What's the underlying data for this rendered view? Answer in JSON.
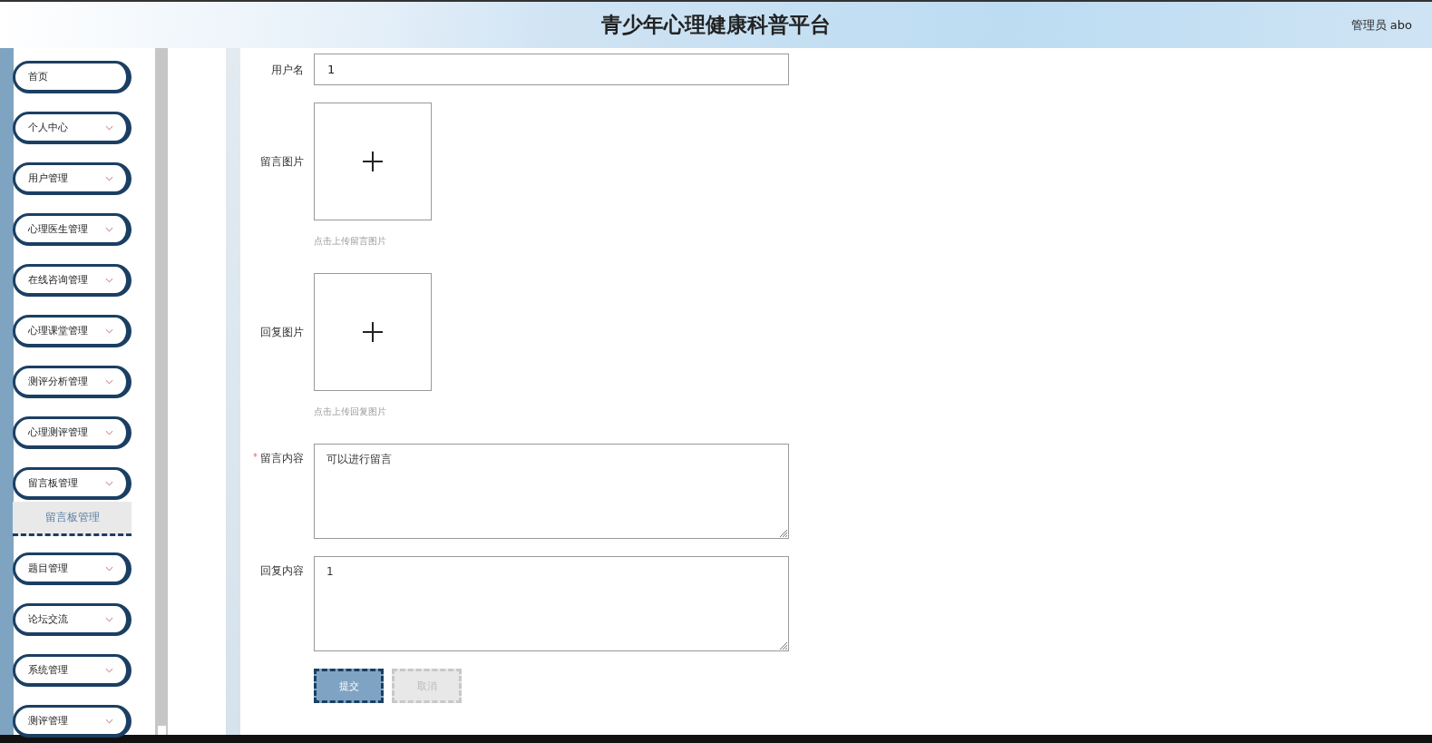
{
  "header": {
    "title": "青少年心理健康科普平台",
    "user": "管理员 abo"
  },
  "sidebar": {
    "items": [
      {
        "label": "首页",
        "kind": "link"
      },
      {
        "label": "个人中心",
        "kind": "group"
      },
      {
        "label": "用户管理",
        "kind": "group"
      },
      {
        "label": "心理医生管理",
        "kind": "group"
      },
      {
        "label": "在线咨询管理",
        "kind": "group"
      },
      {
        "label": "心理课堂管理",
        "kind": "group"
      },
      {
        "label": "测评分析管理",
        "kind": "group"
      },
      {
        "label": "心理测评管理",
        "kind": "group"
      },
      {
        "label": "留言板管理",
        "kind": "group",
        "children": [
          {
            "label": "留言板管理",
            "selected": true
          }
        ]
      },
      {
        "label": "题目管理",
        "kind": "group"
      },
      {
        "label": "论坛交流",
        "kind": "group"
      },
      {
        "label": "系统管理",
        "kind": "group"
      },
      {
        "label": "测评管理",
        "kind": "group"
      }
    ]
  },
  "form": {
    "fields": [
      {
        "kind": "input",
        "label": "用户名",
        "value": "1"
      },
      {
        "kind": "upload",
        "label": "留言图片",
        "hint": "点击上传留言图片"
      },
      {
        "kind": "upload",
        "label": "回复图片",
        "hint": "点击上传回复图片"
      },
      {
        "kind": "textarea",
        "label": "留言内容",
        "value": "可以进行留言",
        "required_mark": "*"
      },
      {
        "kind": "textarea",
        "label": "回复内容",
        "value": "1"
      }
    ],
    "buttons": [
      {
        "label": "提交",
        "disabled": false
      },
      {
        "label": "取消",
        "disabled": true
      }
    ]
  }
}
